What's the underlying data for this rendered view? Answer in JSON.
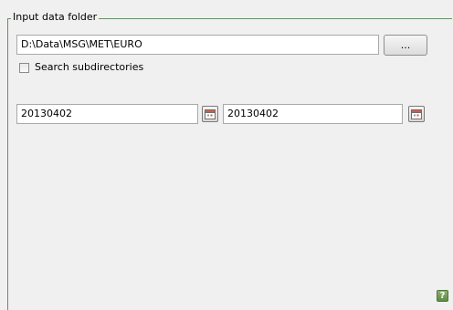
{
  "group": {
    "title": "Input data folder"
  },
  "folder": {
    "value": "D:\\Data\\MSG\\MET\\EURO",
    "browse_label": "..."
  },
  "options": {
    "search_subdirectories_label": "Search subdirectories",
    "search_subdirectories_checked": false
  },
  "dates": {
    "start_value": "20130402",
    "end_value": "20130402"
  },
  "help": {
    "label": "?"
  },
  "colors": {
    "frame_line": "#6b8c6b",
    "help_icon": "#5f8a44"
  },
  "icons": {
    "calendar": "calendar-icon",
    "help": "help-icon"
  }
}
